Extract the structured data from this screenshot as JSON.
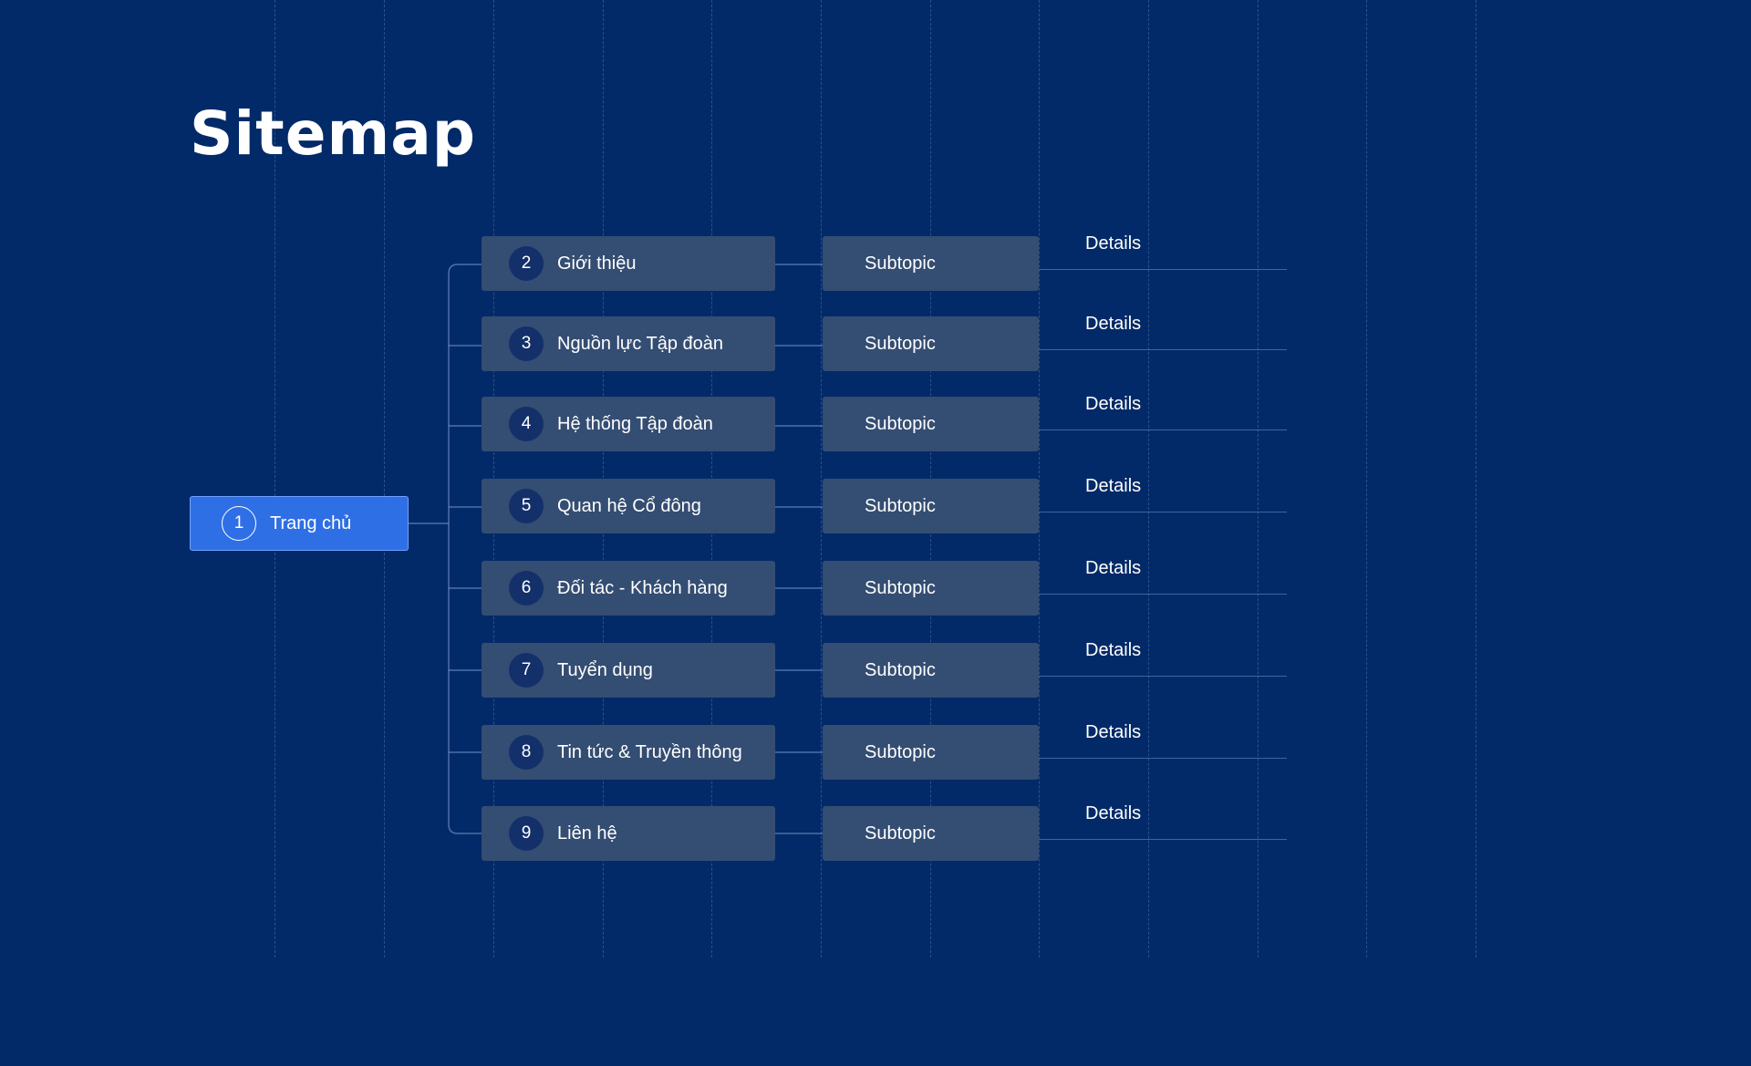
{
  "title": "Sitemap",
  "root": {
    "number": "1",
    "label": "Trang chủ"
  },
  "topics": [
    {
      "number": "2",
      "label": "Giới thiệu",
      "subtopic": "Subtopic",
      "details": "Details"
    },
    {
      "number": "3",
      "label": "Nguồn lực Tập đoàn",
      "subtopic": "Subtopic",
      "details": "Details"
    },
    {
      "number": "4",
      "label": "Hệ thống Tập đoàn",
      "subtopic": "Subtopic",
      "details": "Details"
    },
    {
      "number": "5",
      "label": "Quan hệ Cổ đông",
      "subtopic": "Subtopic",
      "details": "Details"
    },
    {
      "number": "6",
      "label": "Đối tác - Khách hàng",
      "subtopic": "Subtopic",
      "details": "Details"
    },
    {
      "number": "7",
      "label": "Tuyển dụng",
      "subtopic": "Subtopic",
      "details": "Details"
    },
    {
      "number": "8",
      "label": "Tin tức & Truyền thông",
      "subtopic": "Subtopic",
      "details": "Details"
    },
    {
      "number": "9",
      "label": "Liên hệ",
      "subtopic": "Subtopic",
      "details": "Details"
    }
  ],
  "colors": {
    "background": "#032a68",
    "root_node": "#2f6fe6",
    "topic_node": "#344d72",
    "number_badge": "#13306a"
  }
}
